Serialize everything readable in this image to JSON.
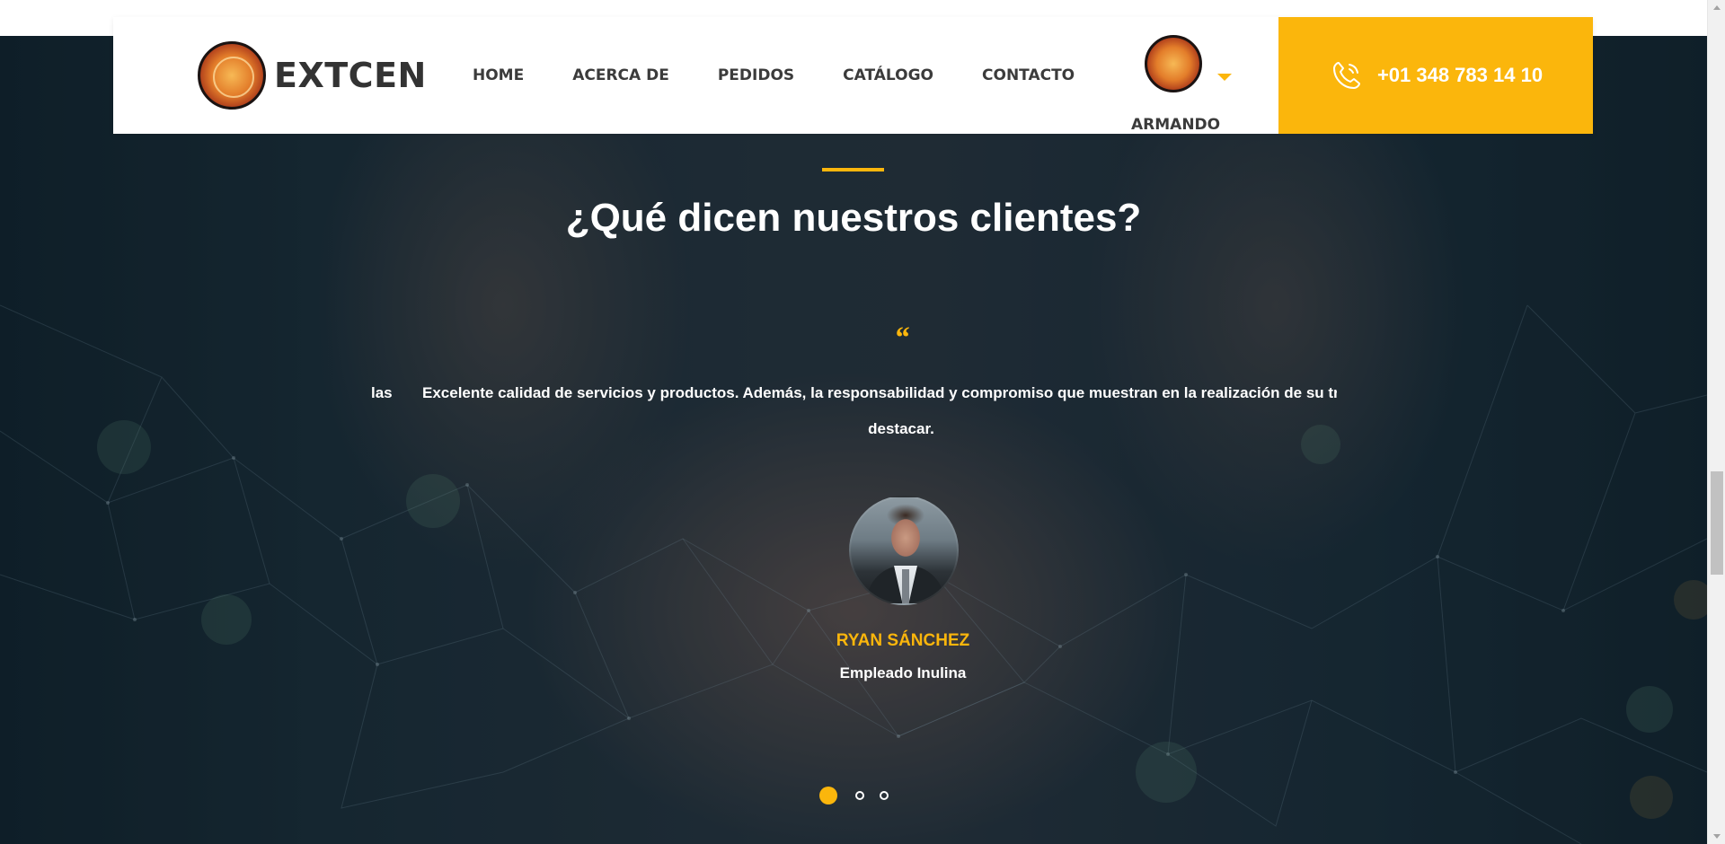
{
  "brand": {
    "name": "EXTCEN",
    "logo_icon": "extcen-seal-logo"
  },
  "nav": {
    "items": [
      {
        "label": "HOME"
      },
      {
        "label": "ACERCA DE"
      },
      {
        "label": "PEDIDOS"
      },
      {
        "label": "CATÁLOGO"
      },
      {
        "label": "CONTACTO"
      }
    ]
  },
  "user": {
    "name": "ARMANDO",
    "avatar_icon": "extcen-seal-avatar",
    "menu_icon": "caret-down-icon"
  },
  "contact": {
    "phone": "+01 348 783 14 10",
    "icon": "phone-icon"
  },
  "testimonials": {
    "title": "¿Qué dicen nuestros clientes?",
    "quote_mark": "“",
    "prev_fragment": "las",
    "quote_line1": "Excelente calidad de servicios y productos. Además, la responsabilidad y compromiso que muestran en la realización de su trabajo",
    "quote_line2": "destacar.",
    "client": {
      "name": "RYAN SÁNCHEZ",
      "role": "Empleado Inulina"
    },
    "slides": 3,
    "active_slide": 1
  },
  "colors": {
    "accent": "#fbb60c",
    "text_dark": "#3b3b3b",
    "overlay": "#1c2e3a"
  }
}
